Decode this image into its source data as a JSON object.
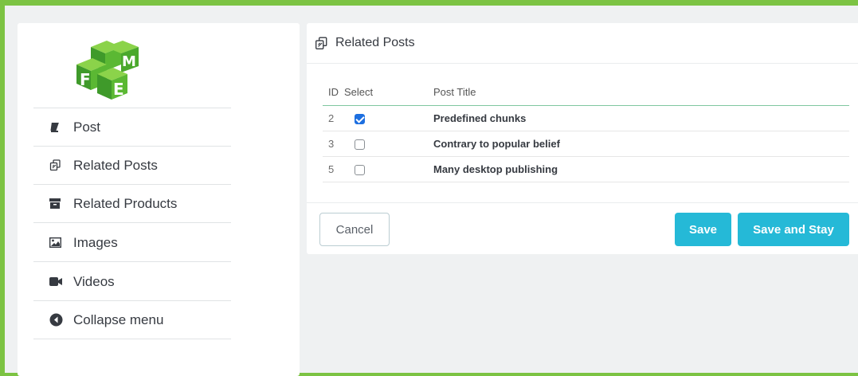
{
  "sidebar": {
    "logo": {
      "letters": [
        "F",
        "M",
        "E"
      ],
      "color": "#4caf50"
    },
    "items": [
      {
        "label": "Post",
        "icon": "book-icon"
      },
      {
        "label": "Related Posts",
        "icon": "clone-icon"
      },
      {
        "label": "Related Products",
        "icon": "archive-icon"
      },
      {
        "label": "Images",
        "icon": "image-icon"
      },
      {
        "label": "Videos",
        "icon": "video-camera-icon"
      },
      {
        "label": "Collapse menu",
        "icon": "circle-chevron-left-icon"
      }
    ]
  },
  "panel": {
    "title": "Related Posts",
    "title_icon": "clone-icon",
    "table": {
      "headers": {
        "id": "ID",
        "select": "Select",
        "title": "Post Title"
      },
      "rows": [
        {
          "id": "2",
          "checked": true,
          "title": "Predefined chunks"
        },
        {
          "id": "3",
          "checked": false,
          "title": "Contrary to popular belief"
        },
        {
          "id": "5",
          "checked": false,
          "title": "Many desktop publishing"
        }
      ]
    },
    "buttons": {
      "cancel": "Cancel",
      "save": "Save",
      "save_and_stay": "Save and Stay"
    }
  },
  "colors": {
    "frame_border": "#7cc343",
    "primary_button": "#25b9d7",
    "checkbox_checked": "#1d6fe0",
    "background": "#eff1f2"
  }
}
